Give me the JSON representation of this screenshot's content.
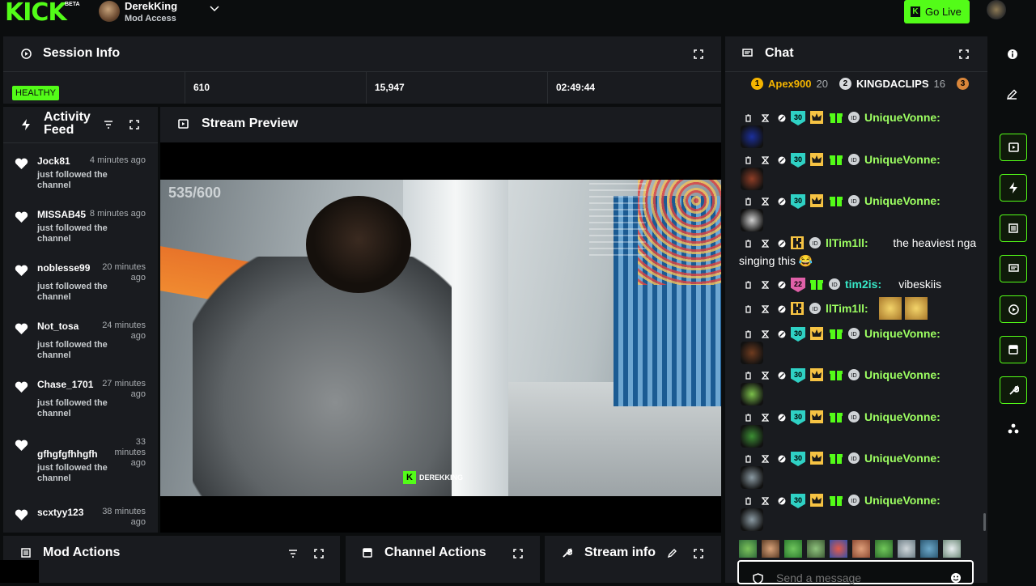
{
  "topbar": {
    "logo": "KICK",
    "beta": "BETA",
    "username": "DerekKing",
    "role": "Mod Access",
    "go_live": "Go Live"
  },
  "session": {
    "title": "Session Info",
    "status": "HEALTHY",
    "stats": [
      "610",
      "15,947",
      "02:49:44"
    ]
  },
  "activity": {
    "title_line1": "Activity",
    "title_line2": "Feed",
    "items": [
      {
        "name": "Jock81",
        "time": "4 minutes ago",
        "desc": "just followed the channel"
      },
      {
        "name": "MISSAB45",
        "time": "8 minutes ago",
        "desc": "just followed the channel"
      },
      {
        "name": "noblesse99",
        "time": "20 minutes ago",
        "desc": "just followed the channel"
      },
      {
        "name": "Not_tosa",
        "time": "24 minutes ago",
        "desc": "just followed the channel"
      },
      {
        "name": "Chase_1701",
        "time": "27 minutes ago",
        "desc": "just followed the channel"
      },
      {
        "name": "gfhgfgfhhgfh",
        "time": "33 minutes ago",
        "desc": "just followed the channel"
      },
      {
        "name": "scxtyy123",
        "time": "38 minutes ago",
        "desc": ""
      }
    ]
  },
  "preview": {
    "title": "Stream Preview",
    "overlay_count": "535/600",
    "watermark": "DEREKKING"
  },
  "bottom": {
    "mod_actions": "Mod Actions",
    "channel_actions": "Channel Actions",
    "stream_info": "Stream info"
  },
  "chat": {
    "title": "Chat",
    "leaders": [
      {
        "rank": "1",
        "name": "Apex900",
        "count": "20"
      },
      {
        "rank": "2",
        "name": "KINGDACLIPS",
        "count": "16"
      },
      {
        "rank": "3",
        "name": "",
        "count": ""
      }
    ],
    "messages": [
      {
        "badge": "30",
        "user": "UniqueVonne:",
        "text": "",
        "color": "#9dff62"
      },
      {
        "badge": "30",
        "user": "UniqueVonne:",
        "text": "",
        "color": "#9dff62"
      },
      {
        "badge": "30",
        "user": "UniqueVonne:",
        "text": "",
        "color": "#9dff62"
      },
      {
        "badge": "",
        "user": "llTim1ll:",
        "text": "the heaviest nga",
        "text2": "singing this 😂",
        "color": "#9dff62"
      },
      {
        "badge": "22",
        "user": "tim2is:",
        "text": "vibeskiis",
        "color": "#37e8c7"
      },
      {
        "badge": "",
        "user": "llTim1ll:",
        "text": "",
        "color": "#9dff62"
      },
      {
        "badge": "30",
        "user": "UniqueVonne:",
        "text": "",
        "color": "#9dff62"
      },
      {
        "badge": "30",
        "user": "UniqueVonne:",
        "text": "",
        "color": "#9dff62"
      },
      {
        "badge": "30",
        "user": "UniqueVonne:",
        "text": "",
        "color": "#9dff62"
      },
      {
        "badge": "30",
        "user": "UniqueVonne:",
        "text": "",
        "color": "#9dff62"
      },
      {
        "badge": "30",
        "user": "UniqueVonne:",
        "text": "",
        "color": "#9dff62"
      }
    ],
    "input_placeholder": "Send a message"
  },
  "colors": {
    "accent": "#53fc18",
    "panel": "#191b1f",
    "background": "#0b0d0e"
  }
}
